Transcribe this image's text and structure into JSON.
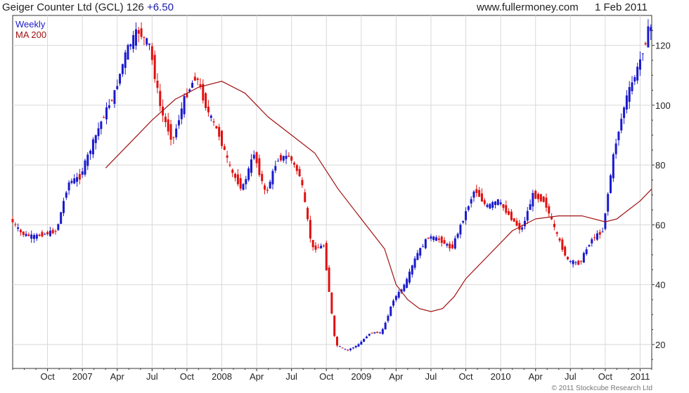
{
  "header": {
    "name": "Geiger Counter Ltd (GCL)",
    "price": "126",
    "change": "+6.50",
    "site": "www.fullermoney.com",
    "date": "1 Feb 2011"
  },
  "footer": {
    "copyright": "© 2011 Stockcube Research Ltd"
  },
  "colors": {
    "up": "#1a1acc",
    "down": "#e01010",
    "ma": "#a01010",
    "grid": "#d8d8d8",
    "axis": "#333333"
  },
  "chart_data": {
    "type": "ohlc-candle",
    "legend": [
      "Weekly",
      "MA 200"
    ],
    "x_start": "2006-07",
    "x_end": "2011-02",
    "ylim": [
      12,
      130
    ],
    "y_ticks": [
      20,
      40,
      60,
      80,
      100,
      120
    ],
    "x_ticks": [
      {
        "label": "Oct",
        "t": "2006-10"
      },
      {
        "label": "2007",
        "t": "2007-01"
      },
      {
        "label": "Apr",
        "t": "2007-04"
      },
      {
        "label": "Jul",
        "t": "2007-07"
      },
      {
        "label": "Oct",
        "t": "2007-10"
      },
      {
        "label": "2008",
        "t": "2008-01"
      },
      {
        "label": "Apr",
        "t": "2008-04"
      },
      {
        "label": "Jul",
        "t": "2008-07"
      },
      {
        "label": "Oct",
        "t": "2008-10"
      },
      {
        "label": "2009",
        "t": "2009-01"
      },
      {
        "label": "Apr",
        "t": "2009-04"
      },
      {
        "label": "Jul",
        "t": "2009-07"
      },
      {
        "label": "Oct",
        "t": "2009-10"
      },
      {
        "label": "2010",
        "t": "2010-01"
      },
      {
        "label": "Apr",
        "t": "2010-04"
      },
      {
        "label": "Jul",
        "t": "2010-07"
      },
      {
        "label": "Oct",
        "t": "2010-10"
      },
      {
        "label": "2011",
        "t": "2011-01"
      }
    ],
    "price_path": [
      [
        "2006-07",
        62
      ],
      [
        "2006-08",
        57
      ],
      [
        "2006-09",
        56
      ],
      [
        "2006-10",
        57
      ],
      [
        "2006-11",
        58
      ],
      [
        "2006-12",
        74
      ],
      [
        "2007-01",
        76
      ],
      [
        "2007-02",
        86
      ],
      [
        "2007-03",
        96
      ],
      [
        "2007-04",
        104
      ],
      [
        "2007-05",
        118
      ],
      [
        "2007-06",
        125
      ],
      [
        "2007-07",
        120
      ],
      [
        "2007-08",
        98
      ],
      [
        "2007-09",
        88
      ],
      [
        "2007-10",
        102
      ],
      [
        "2007-11",
        110
      ],
      [
        "2007-12",
        98
      ],
      [
        "2008-01",
        90
      ],
      [
        "2008-02",
        78
      ],
      [
        "2008-03",
        72
      ],
      [
        "2008-04",
        84
      ],
      [
        "2008-05",
        70
      ],
      [
        "2008-06",
        82
      ],
      [
        "2008-07",
        83
      ],
      [
        "2008-08",
        76
      ],
      [
        "2008-09",
        52
      ],
      [
        "2008-10",
        53
      ],
      [
        "2008-11",
        20
      ],
      [
        "2008-12",
        18
      ],
      [
        "2009-01",
        20
      ],
      [
        "2009-02",
        24
      ],
      [
        "2009-03",
        24
      ],
      [
        "2009-04",
        35
      ],
      [
        "2009-05",
        40
      ],
      [
        "2009-06",
        50
      ],
      [
        "2009-07",
        56
      ],
      [
        "2009-08",
        55
      ],
      [
        "2009-09",
        52
      ],
      [
        "2009-10",
        62
      ],
      [
        "2009-11",
        72
      ],
      [
        "2009-12",
        66
      ],
      [
        "2010-01",
        68
      ],
      [
        "2010-02",
        63
      ],
      [
        "2010-03",
        58
      ],
      [
        "2010-04",
        70
      ],
      [
        "2010-05",
        68
      ],
      [
        "2010-06",
        57
      ],
      [
        "2010-07",
        48
      ],
      [
        "2010-08",
        47
      ],
      [
        "2010-09",
        55
      ],
      [
        "2010-10",
        58
      ],
      [
        "2010-11",
        85
      ],
      [
        "2010-12",
        102
      ],
      [
        "2011-01",
        112
      ],
      [
        "2011-02",
        126
      ]
    ],
    "ma200": [
      [
        "2007-03",
        79
      ],
      [
        "2007-05",
        87
      ],
      [
        "2007-07",
        95
      ],
      [
        "2007-09",
        102
      ],
      [
        "2007-11",
        106
      ],
      [
        "2008-01",
        108
      ],
      [
        "2008-03",
        104
      ],
      [
        "2008-05",
        96
      ],
      [
        "2008-07",
        90
      ],
      [
        "2008-09",
        84
      ],
      [
        "2008-11",
        72
      ],
      [
        "2009-01",
        62
      ],
      [
        "2009-03",
        52
      ],
      [
        "2009-04",
        40
      ],
      [
        "2009-05",
        35
      ],
      [
        "2009-06",
        32
      ],
      [
        "2009-07",
        31
      ],
      [
        "2009-08",
        32
      ],
      [
        "2009-09",
        36
      ],
      [
        "2009-10",
        42
      ],
      [
        "2009-12",
        50
      ],
      [
        "2010-02",
        58
      ],
      [
        "2010-04",
        62
      ],
      [
        "2010-06",
        63
      ],
      [
        "2010-08",
        63
      ],
      [
        "2010-10",
        61
      ],
      [
        "2010-11",
        62
      ],
      [
        "2010-12",
        65
      ],
      [
        "2011-01",
        68
      ],
      [
        "2011-02",
        72
      ]
    ]
  }
}
